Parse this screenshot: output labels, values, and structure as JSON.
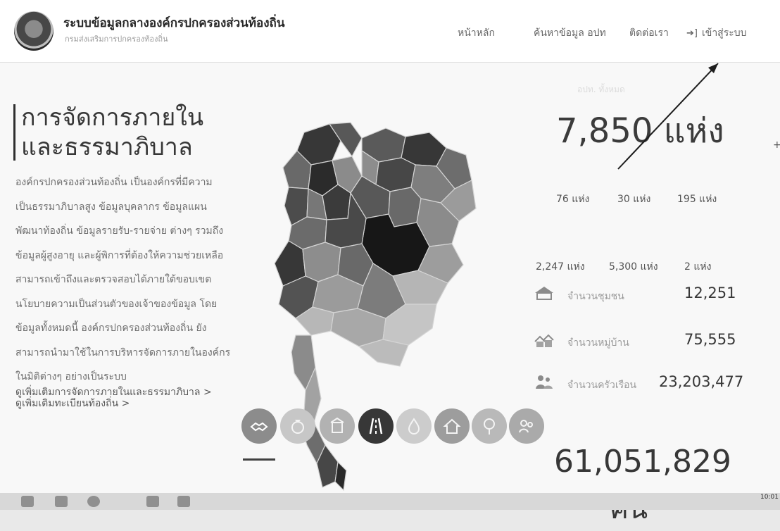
{
  "header": {
    "site_title": "ระบบข้อมูลกลางองค์กรปกครองส่วนท้องถิ่น",
    "site_subtitle": "กรมส่งเสริมการปกครองท้องถิ่น",
    "nav": [
      "หน้าหลัก",
      "ค้นหาข้อมูล อปท",
      "ติดต่อเรา"
    ],
    "login_label": "เข้าสู่ระบบ"
  },
  "hero": {
    "heading_line1": "การจัดการภายใน",
    "heading_line2": "และธรรมาภิบาล",
    "intro_lines": [
      "องค์กรปกครองส่วนท้องถิ่น เป็นองค์กรที่มีความ",
      "เป็นธรรมาภิบาลสูง ข้อมูลบุคลากร ข้อมูลแผน",
      "พัฒนาท้องถิ่น ข้อมูลรายรับ-รายจ่าย ต่างๆ รวมถึง",
      "ข้อมูลผู้สูงอายุ และผู้พิการที่ต้องให้ความช่วยเหลือ",
      "สามารถเข้าถึงและตรวจสอบได้ภายใต้ขอบเขต",
      "นโยบายความเป็นส่วนตัวของเจ้าของข้อมูล โดย",
      "ข้อมูลทั้งหมดนี้ องค์กรปกครองส่วนท้องถิ่น ยัง",
      "สามารถนำมาใช้ในการบริหารจัดการภายในองค์กร",
      "ในมิติต่างๆ อย่างเป็นระบบ"
    ],
    "link_more_governance": "ดูเพิ่มเติมการจัดการภายในและธรรมาภิบาล >",
    "link_more_registration": "ดูเพิ่มเติมทะเบียนท้องถิ่น >"
  },
  "stats": {
    "total_label": "อปท. ทั้งหมด",
    "total": "7,850 แห่ง",
    "row1": [
      "76 แห่ง",
      "30 แห่ง",
      "195 แห่ง"
    ],
    "row2": [
      "2,247 แห่ง",
      "5,300 แห่ง",
      "2 แห่ง"
    ],
    "communities_label": "จำนวนชุมชน",
    "communities_value": "12,251",
    "villages_label": "จำนวนหมู่บ้าน",
    "villages_value": "75,555",
    "households_label": "จำนวนครัวเรือน",
    "households_value": "23,203,477",
    "population": "61,051,829",
    "population_unit": "คน"
  },
  "category_icons": [
    "handshake-icon",
    "money-bag-icon",
    "building-icon",
    "road-icon",
    "water-icon",
    "house-icon",
    "tree-icon",
    "people-icon"
  ],
  "colors": {
    "map_dark": "#2e2e2e",
    "map_mid": "#6a6a6a",
    "map_light": "#a8a8a8",
    "highlight": "#1c1c1c"
  },
  "taskbar": {
    "time": "10:01"
  }
}
